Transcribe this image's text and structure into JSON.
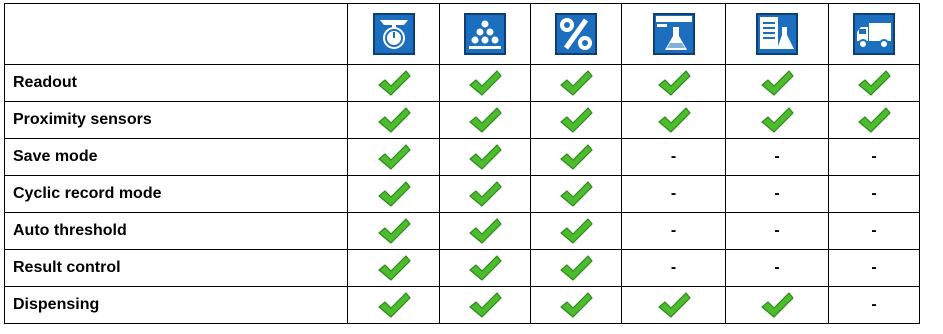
{
  "modes": [
    {
      "icon": "weighing-scale-icon"
    },
    {
      "icon": "parts-counting-icon"
    },
    {
      "icon": "percent-weighing-icon"
    },
    {
      "icon": "formulation-flask-icon"
    },
    {
      "icon": "recipes-document-flask-icon"
    },
    {
      "icon": "truck-icon"
    }
  ],
  "rows": [
    {
      "label": "Readout",
      "values": [
        "check",
        "check",
        "check",
        "check",
        "check",
        "check"
      ]
    },
    {
      "label": "Proximity sensors",
      "values": [
        "check",
        "check",
        "check",
        "check",
        "check",
        "check"
      ]
    },
    {
      "label": "Save mode",
      "values": [
        "check",
        "check",
        "check",
        "-",
        "-",
        "-"
      ]
    },
    {
      "label": "Cyclic record mode",
      "values": [
        "check",
        "check",
        "check",
        "-",
        "-",
        "-"
      ]
    },
    {
      "label": "Auto threshold",
      "values": [
        "check",
        "check",
        "check",
        "-",
        "-",
        "-"
      ]
    },
    {
      "label": "Result control",
      "values": [
        "check",
        "check",
        "check",
        "-",
        "-",
        "-"
      ]
    },
    {
      "label": "Dispensing",
      "values": [
        "check",
        "check",
        "check",
        "check",
        "check",
        "-"
      ]
    }
  ],
  "colors": {
    "icon_bg": "#1c6fbf",
    "icon_border": "#0d3f73",
    "check_green": "#4cbb2e"
  }
}
